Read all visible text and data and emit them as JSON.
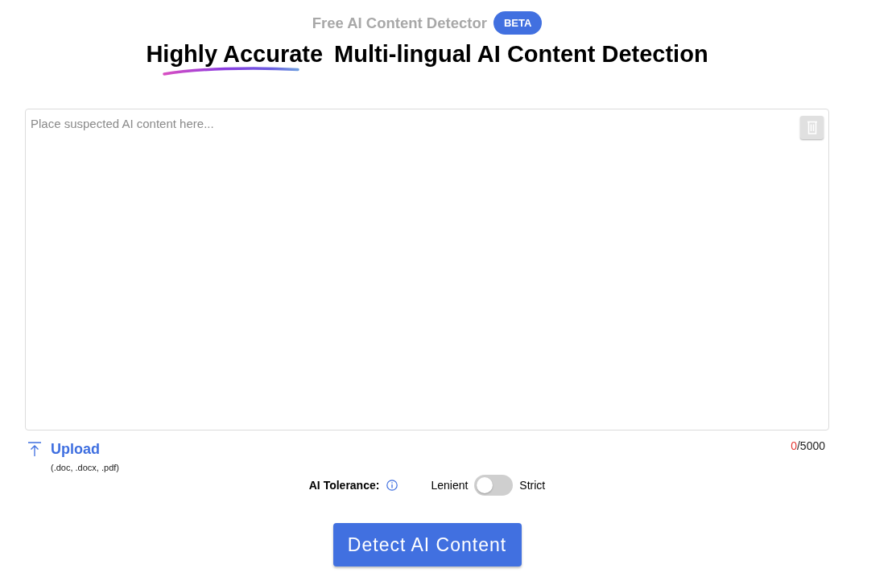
{
  "header": {
    "subtitle": "Free AI Content Detector",
    "badge": "BETA",
    "headline": {
      "highlight": "Highly Accurate",
      "rest": "Multi-lingual AI Content Detection"
    }
  },
  "editor": {
    "placeholder": "Place suspected AI content here..."
  },
  "upload": {
    "label": "Upload",
    "formats": "(.doc, .docx, .pdf)"
  },
  "counter": {
    "count": "0",
    "limit": "/5000"
  },
  "tolerance": {
    "label": "AI Tolerance:",
    "left": "Lenient",
    "right": "Strict",
    "on": false
  },
  "detect_button": {
    "label": "Detect AI Content"
  }
}
